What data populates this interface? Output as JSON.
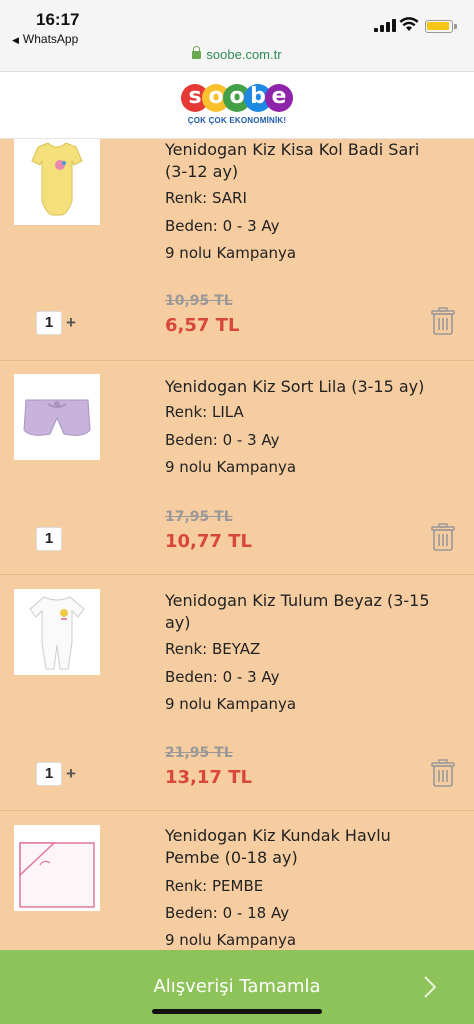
{
  "status": {
    "time": "16:17",
    "back_app": "WhatsApp"
  },
  "browser": {
    "url": "soobe.com.tr"
  },
  "brand": {
    "logo_letters": [
      "s",
      "o",
      "o",
      "b",
      "e"
    ],
    "logo_colors": [
      "#e53935",
      "#fbc02d",
      "#43a047",
      "#1e88e5",
      "#8e24aa"
    ],
    "tagline": "ÇOK ÇOK EKONOMİNİK!"
  },
  "items": [
    {
      "name": "Yenidogan Kiz Kisa Kol Badi Sari (3-12 ay)",
      "color": "Renk: SARI",
      "size": "Beden: 0 - 3 Ay",
      "campaign": "9 nolu Kampanya",
      "old_price": "10,95 TL",
      "new_price": "6,57 TL",
      "qty": "1",
      "plus": "+"
    },
    {
      "name": "Yenidogan Kiz Sort Lila (3-15 ay)",
      "color": "Renk: LILA",
      "size": "Beden: 0 - 3 Ay",
      "campaign": "9 nolu Kampanya",
      "old_price": "17,95 TL",
      "new_price": "10,77 TL",
      "qty": "1",
      "plus": ""
    },
    {
      "name": "Yenidogan Kiz Tulum Beyaz (3-15 ay)",
      "color": "Renk: BEYAZ",
      "size": "Beden: 0 - 3 Ay",
      "campaign": "9 nolu Kampanya",
      "old_price": "21,95 TL",
      "new_price": "13,17 TL",
      "qty": "1",
      "plus": "+"
    },
    {
      "name": "Yenidogan Kiz Kundak Havlu Pembe (0-18 ay)",
      "color": "Renk: PEMBE",
      "size": "Beden: 0 - 18 Ay",
      "campaign": "9 nolu Kampanya"
    }
  ],
  "checkout": {
    "label": "Alışverişi Tamamla"
  },
  "colors": {
    "background": "#f6cda0",
    "price": "#d9473a",
    "checkout": "#8dc358"
  }
}
